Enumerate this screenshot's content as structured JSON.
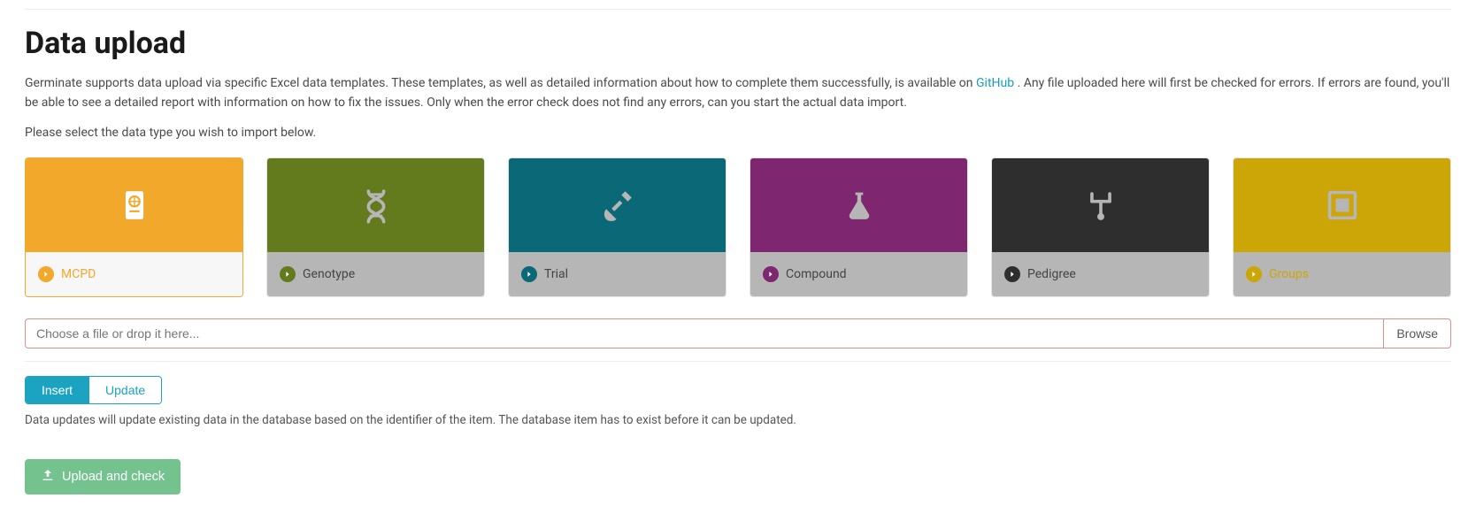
{
  "header": {
    "title": "Data upload",
    "intro_prefix": "Germinate supports data upload via specific Excel data templates. These templates, as well as detailed information about how to complete them successfully, is available on ",
    "link_text": "GitHub",
    "intro_suffix": ". Any file uploaded here will first be checked for errors. If errors are found, you'll be able to see a detailed report with information on how to fix the issues. Only when the error check does not find any errors, can you start the actual data import.",
    "prompt": "Please select the data type you wish to import below."
  },
  "cards": {
    "mcpd": {
      "label": "MCPD"
    },
    "genotype": {
      "label": "Genotype"
    },
    "trial": {
      "label": "Trial"
    },
    "compound": {
      "label": "Compound"
    },
    "pedigree": {
      "label": "Pedigree"
    },
    "groups": {
      "label": "Groups"
    }
  },
  "file": {
    "placeholder": "Choose a file or drop it here...",
    "browse_label": "Browse"
  },
  "toggle": {
    "insert": "Insert",
    "update": "Update"
  },
  "help_text": "Data updates will update existing data in the database based on the identifier of the item. The database item has to exist before it can be updated.",
  "upload": {
    "label": "Upload and check"
  }
}
